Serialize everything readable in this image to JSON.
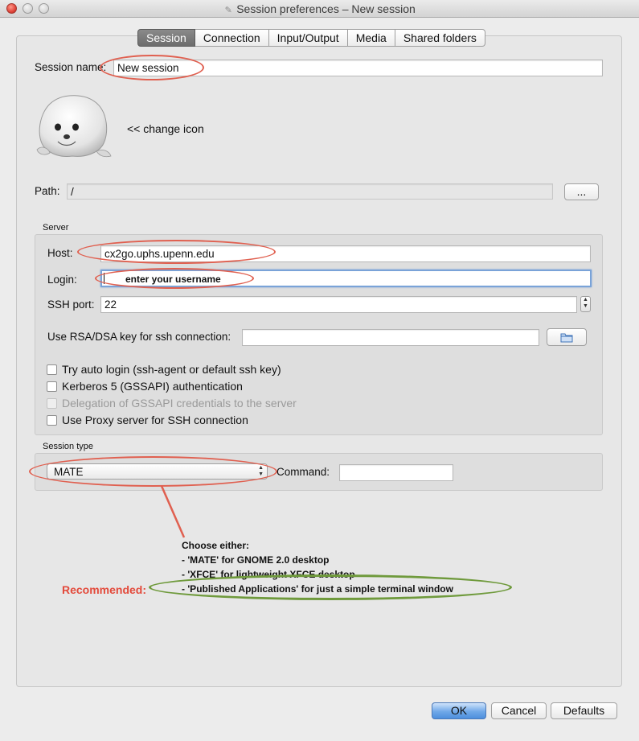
{
  "window": {
    "title": "Session preferences – New session"
  },
  "tabs": [
    {
      "label": "Session",
      "active": true
    },
    {
      "label": "Connection",
      "active": false
    },
    {
      "label": "Input/Output",
      "active": false
    },
    {
      "label": "Media",
      "active": false
    },
    {
      "label": "Shared folders",
      "active": false
    }
  ],
  "session": {
    "name_label": "Session name:",
    "name_value": "New session",
    "change_icon_label": "<< change icon",
    "path_label": "Path:",
    "path_value": "/",
    "path_button": "..."
  },
  "server": {
    "group_label": "Server",
    "host_label": "Host:",
    "host_value": "cx2go.uphs.upenn.edu",
    "login_label": "Login:",
    "login_annotation": "enter your username",
    "ssh_port_label": "SSH port:",
    "ssh_port_value": "22",
    "rsa_label": "Use RSA/DSA key for ssh connection:",
    "rsa_value": "",
    "checkboxes": [
      {
        "label": "Try auto login (ssh-agent or default ssh key)",
        "checked": false,
        "disabled": false
      },
      {
        "label": "Kerberos 5 (GSSAPI) authentication",
        "checked": false,
        "disabled": false
      },
      {
        "label": "Delegation of GSSAPI credentials to the server",
        "checked": false,
        "disabled": true
      },
      {
        "label": "Use Proxy server for SSH connection",
        "checked": false,
        "disabled": false
      }
    ]
  },
  "session_type": {
    "group_label": "Session type",
    "selected": "MATE",
    "command_label": "Command:",
    "command_value": ""
  },
  "annotation": {
    "heading": "Choose either:",
    "line1": "- 'MATE' for GNOME 2.0 desktop",
    "line2": "- 'XFCE' for lightweight XFCE desktop",
    "line3": "- 'Published Applications' for just a simple terminal window",
    "recommended": "Recommended:"
  },
  "footer": {
    "ok": "OK",
    "cancel": "Cancel",
    "defaults": "Defaults"
  },
  "colors": {
    "annotation_red": "#e06050",
    "annotation_green": "#6f9a3c",
    "recommended_text": "#e34a3b"
  }
}
